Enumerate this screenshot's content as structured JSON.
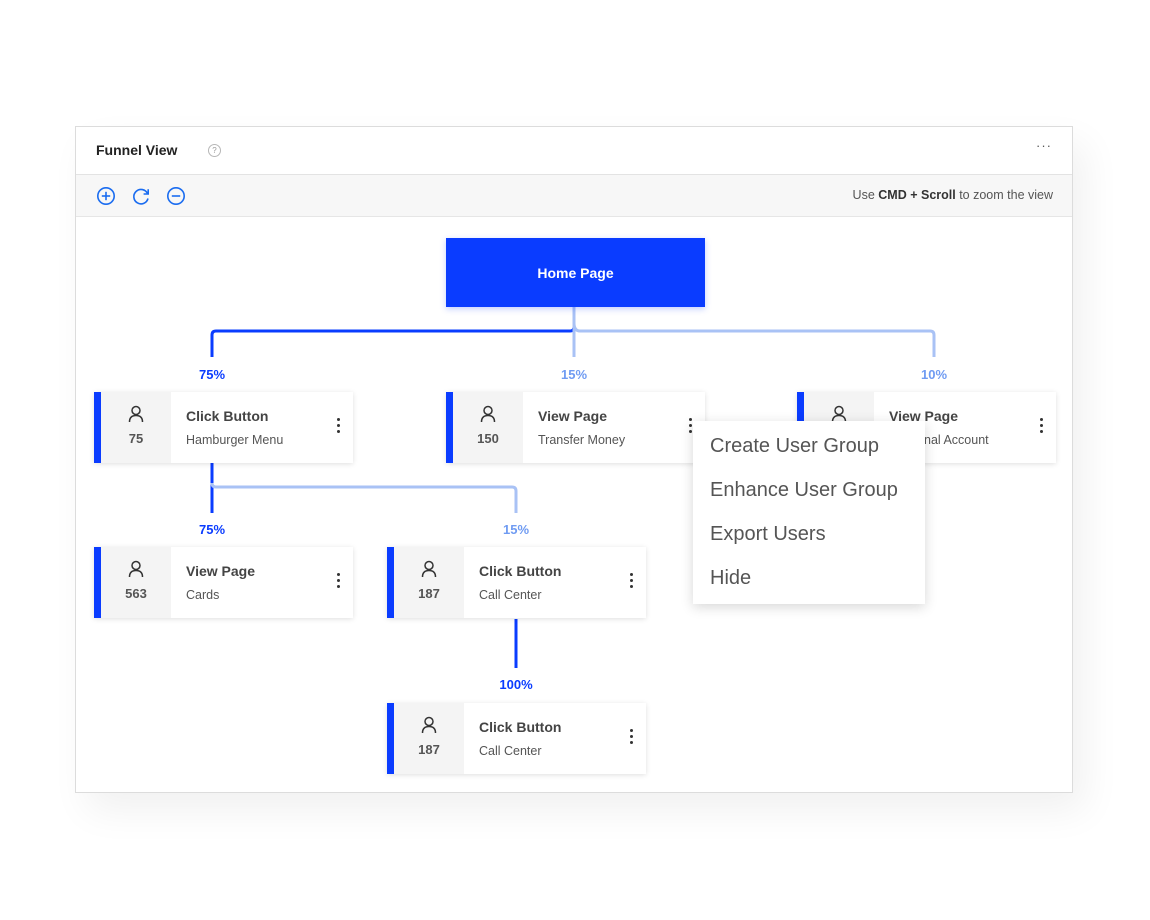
{
  "panel": {
    "title": "Funnel View",
    "help_symbol": "?",
    "more_symbol": "···"
  },
  "toolbar": {
    "zoom_in_icon": "plus-circle",
    "reset_icon": "refresh",
    "zoom_out_icon": "minus-circle",
    "hint_prefix": "Use",
    "hint_keys": "CMD + Scroll",
    "hint_suffix": "to zoom the view"
  },
  "colors": {
    "accent": "#0a3cff",
    "accent_light": "#a9c2f5",
    "percent_light": "#6f9bf2"
  },
  "root": {
    "label": "Home Page"
  },
  "percentages": {
    "click_hamburger": "75%",
    "view_transfer": "15%",
    "view_personal": "10%",
    "view_cards": "75%",
    "call_center_1": "15%",
    "call_center_2": "100%"
  },
  "nodes": {
    "click_hamburger": {
      "count": "75",
      "title": "Click Button",
      "subtitle": "Hamburger Menu"
    },
    "view_transfer": {
      "count": "150",
      "title": "View Page",
      "subtitle": "Transfer Money"
    },
    "view_personal": {
      "count": "",
      "title": "View Page",
      "subtitle": "nal Account"
    },
    "view_cards": {
      "count": "563",
      "title": "View Page",
      "subtitle": "Cards"
    },
    "call_center_1": {
      "count": "187",
      "title": "Click Button",
      "subtitle": "Call Center"
    },
    "call_center_2": {
      "count": "187",
      "title": "Click Button",
      "subtitle": "Call Center"
    }
  },
  "context_menu": {
    "items": [
      "Create User Group",
      "Enhance User Group",
      "Export Users",
      "Hide"
    ]
  }
}
